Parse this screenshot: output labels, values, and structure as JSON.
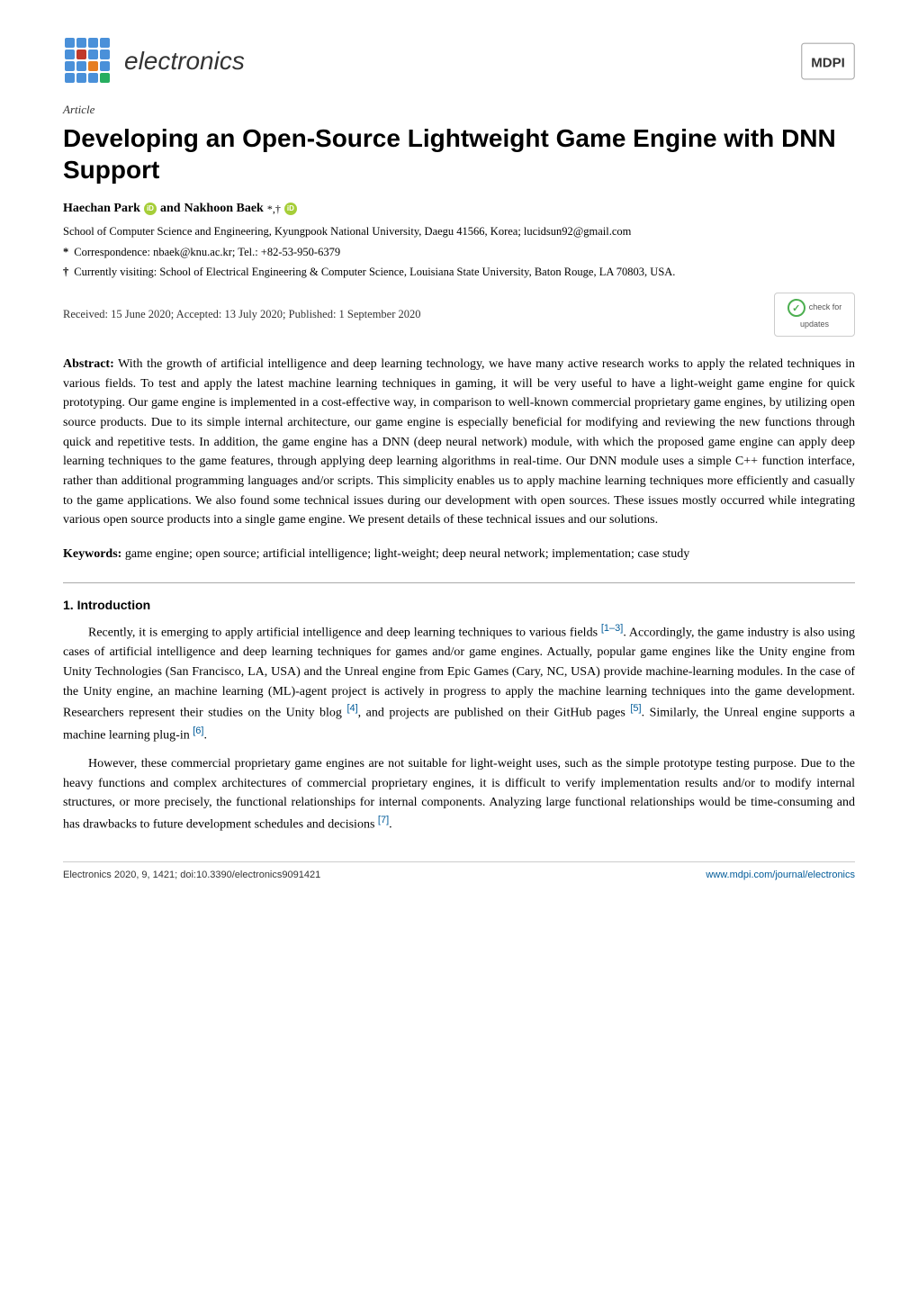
{
  "header": {
    "journal_name": "electronics",
    "mdpi_alt": "MDPI"
  },
  "article": {
    "label": "Article",
    "title": "Developing an Open-Source Lightweight Game Engine with DNN Support",
    "authors_text": "Haechan Park",
    "authors_and": "and",
    "authors_second": "Nakhoon Baek",
    "authors_markers": "*,†",
    "affiliation_main": "School of Computer Science and Engineering, Kyungpook National University, Daegu 41566, Korea; lucidsun92@gmail.com",
    "note_star": "*",
    "note_star_text": "Correspondence: nbaek@knu.ac.kr; Tel.: +82-53-950-6379",
    "note_dagger": "†",
    "note_dagger_text": "Currently visiting: School of Electrical Engineering & Computer Science, Louisiana State University, Baton Rouge, LA 70803, USA.",
    "received": "Received: 15 June 2020; Accepted: 13 July 2020; Published: 1 September 2020",
    "check_updates_line1": "check for",
    "check_updates_line2": "updates",
    "abstract_label": "Abstract:",
    "abstract_text": " With the growth of artificial intelligence and deep learning technology, we have many active research works to apply the related techniques in various fields. To test and apply the latest machine learning techniques in gaming, it will be very useful to have a light-weight game engine for quick prototyping. Our game engine is implemented in a cost-effective way, in comparison to well-known commercial proprietary game engines, by utilizing open source products. Due to its simple internal architecture, our game engine is especially beneficial for modifying and reviewing the new functions through quick and repetitive tests. In addition, the game engine has a DNN (deep neural network) module, with which the proposed game engine can apply deep learning techniques to the game features, through applying deep learning algorithms in real-time. Our DNN module uses a simple C++ function interface, rather than additional programming languages and/or scripts. This simplicity enables us to apply machine learning techniques more efficiently and casually to the game applications. We also found some technical issues during our development with open sources. These issues mostly occurred while integrating various open source products into a single game engine. We present details of these technical issues and our solutions.",
    "keywords_label": "Keywords:",
    "keywords_text": " game engine; open source; artificial intelligence; light-weight; deep neural network; implementation; case study",
    "section1_heading": "1. Introduction",
    "section1_para1": "Recently, it is emerging to apply artificial intelligence and deep learning techniques to various fields [1–3]. Accordingly, the game industry is also using cases of artificial intelligence and deep learning techniques for games and/or game engines. Actually, popular game engines like the Unity engine from Unity Technologies (San Francisco, LA, USA) and the Unreal engine from Epic Games (Cary, NC, USA) provide machine-learning modules. In the case of the Unity engine, an machine learning (ML)-agent project is actively in progress to apply the machine learning techniques into the game development. Researchers represent their studies on the Unity blog [4], and projects are published on their GitHub pages [5]. Similarly, the Unreal engine supports a machine learning plug-in [6].",
    "section1_para2": "However, these commercial proprietary game engines are not suitable for light-weight uses, such as the simple prototype testing purpose. Due to the heavy functions and complex architectures of commercial proprietary engines, it is difficult to verify implementation results and/or to modify internal structures, or more precisely, the functional relationships for internal components. Analyzing large functional relationships would be time-consuming and has drawbacks to future development schedules and decisions [7].",
    "footer_citation": "Electronics 2020, 9, 1421; doi:10.3390/electronics9091421",
    "footer_url": "www.mdpi.com/journal/electronics"
  }
}
